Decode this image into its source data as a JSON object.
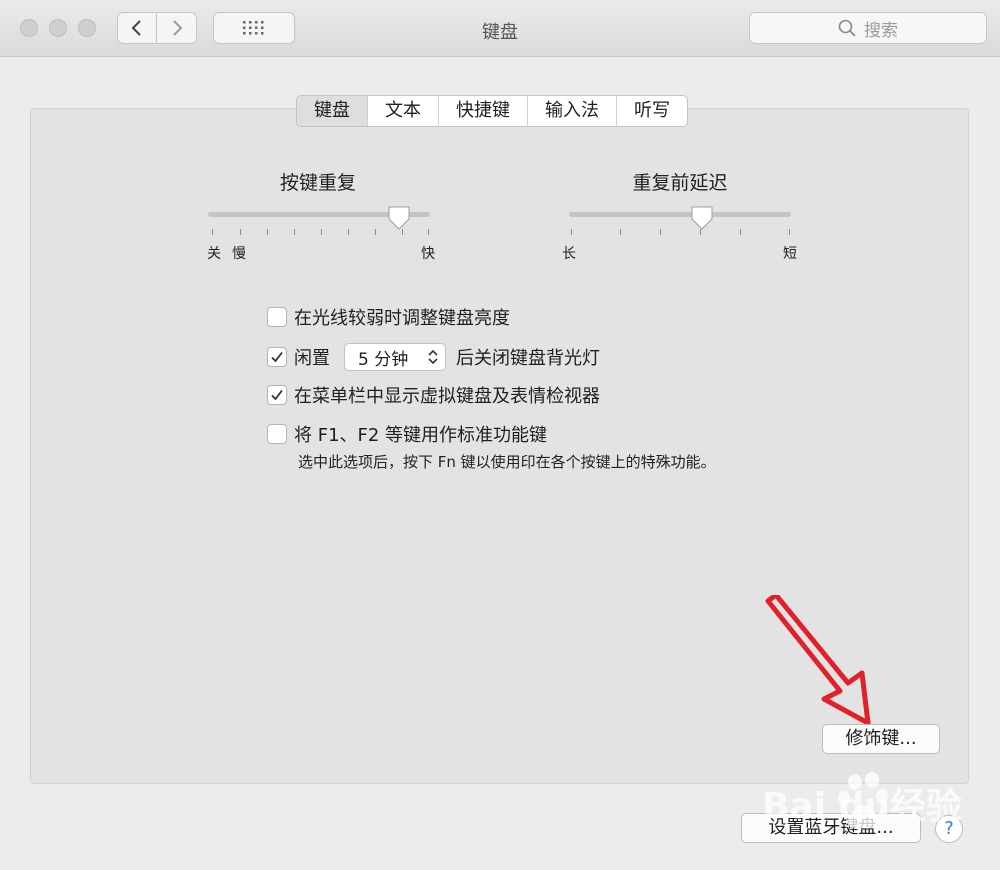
{
  "window": {
    "title": "键盘"
  },
  "search": {
    "placeholder": "搜索"
  },
  "tabs": [
    {
      "label": "键盘",
      "active": true
    },
    {
      "label": "文本",
      "active": false
    },
    {
      "label": "快捷键",
      "active": false
    },
    {
      "label": "输入法",
      "active": false
    },
    {
      "label": "听写",
      "active": false
    }
  ],
  "key_repeat": {
    "title": "按键重复",
    "labels": {
      "off": "关",
      "slow": "慢",
      "fast": "快"
    },
    "position": 0.86
  },
  "delay_until_repeat": {
    "title": "重复前延迟",
    "labels": {
      "long": "长",
      "short": "短"
    },
    "position": 0.6
  },
  "options": {
    "adjust_brightness": {
      "label": "在光线较弱时调整键盘亮度",
      "checked": false
    },
    "backlight_off": {
      "prefix": "闲置",
      "value": "5 分钟",
      "suffix": "后关闭键盘背光灯",
      "checked": true
    },
    "show_viewer": {
      "label": "在菜单栏中显示虚拟键盘及表情检视器",
      "checked": true
    },
    "fn_keys": {
      "label": "将 F1、F2 等键用作标准功能键",
      "checked": false,
      "hint": "选中此选项后，按下 Fn 键以使用印在各个按键上的特殊功能。"
    }
  },
  "buttons": {
    "modifier_keys": "修饰键...",
    "bluetooth_keyboard": "设置蓝牙键盘...",
    "help": "?"
  },
  "watermark": {
    "text": "Baidu经验"
  },
  "colors": {
    "annotation_arrow": "#e0202a",
    "accent": "#3a7ad8"
  }
}
